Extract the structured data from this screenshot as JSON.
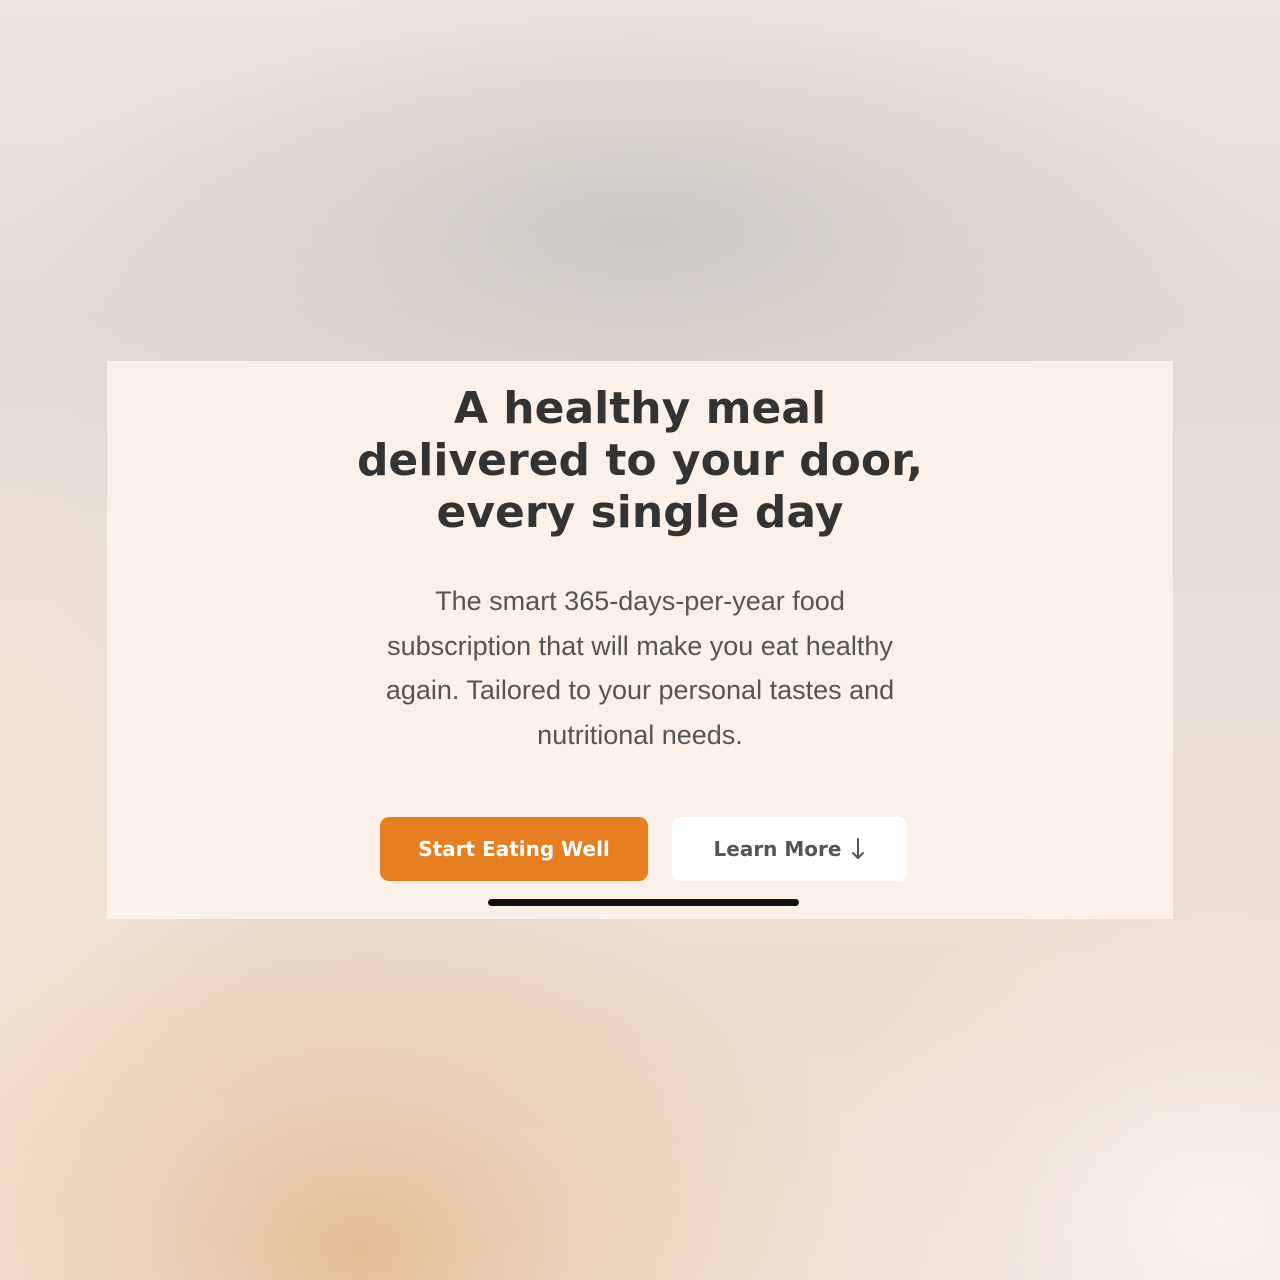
{
  "hero": {
    "headline_lines": [
      "A healthy meal",
      "delivered to your door,",
      "every single day"
    ],
    "description_lines": [
      "The smart 365-days-per-year food",
      "subscription that will make you eat healthy",
      "again. Tailored to your personal tastes and",
      "nutritional needs."
    ]
  },
  "buttons": {
    "primary_label": "Start Eating Well",
    "secondary_label": "Learn More",
    "secondary_icon": "arrow-down-icon"
  },
  "colors": {
    "accent": "#e67e22",
    "card_background": "#fcf1e9",
    "heading_text": "#333333",
    "body_text": "#555555"
  }
}
